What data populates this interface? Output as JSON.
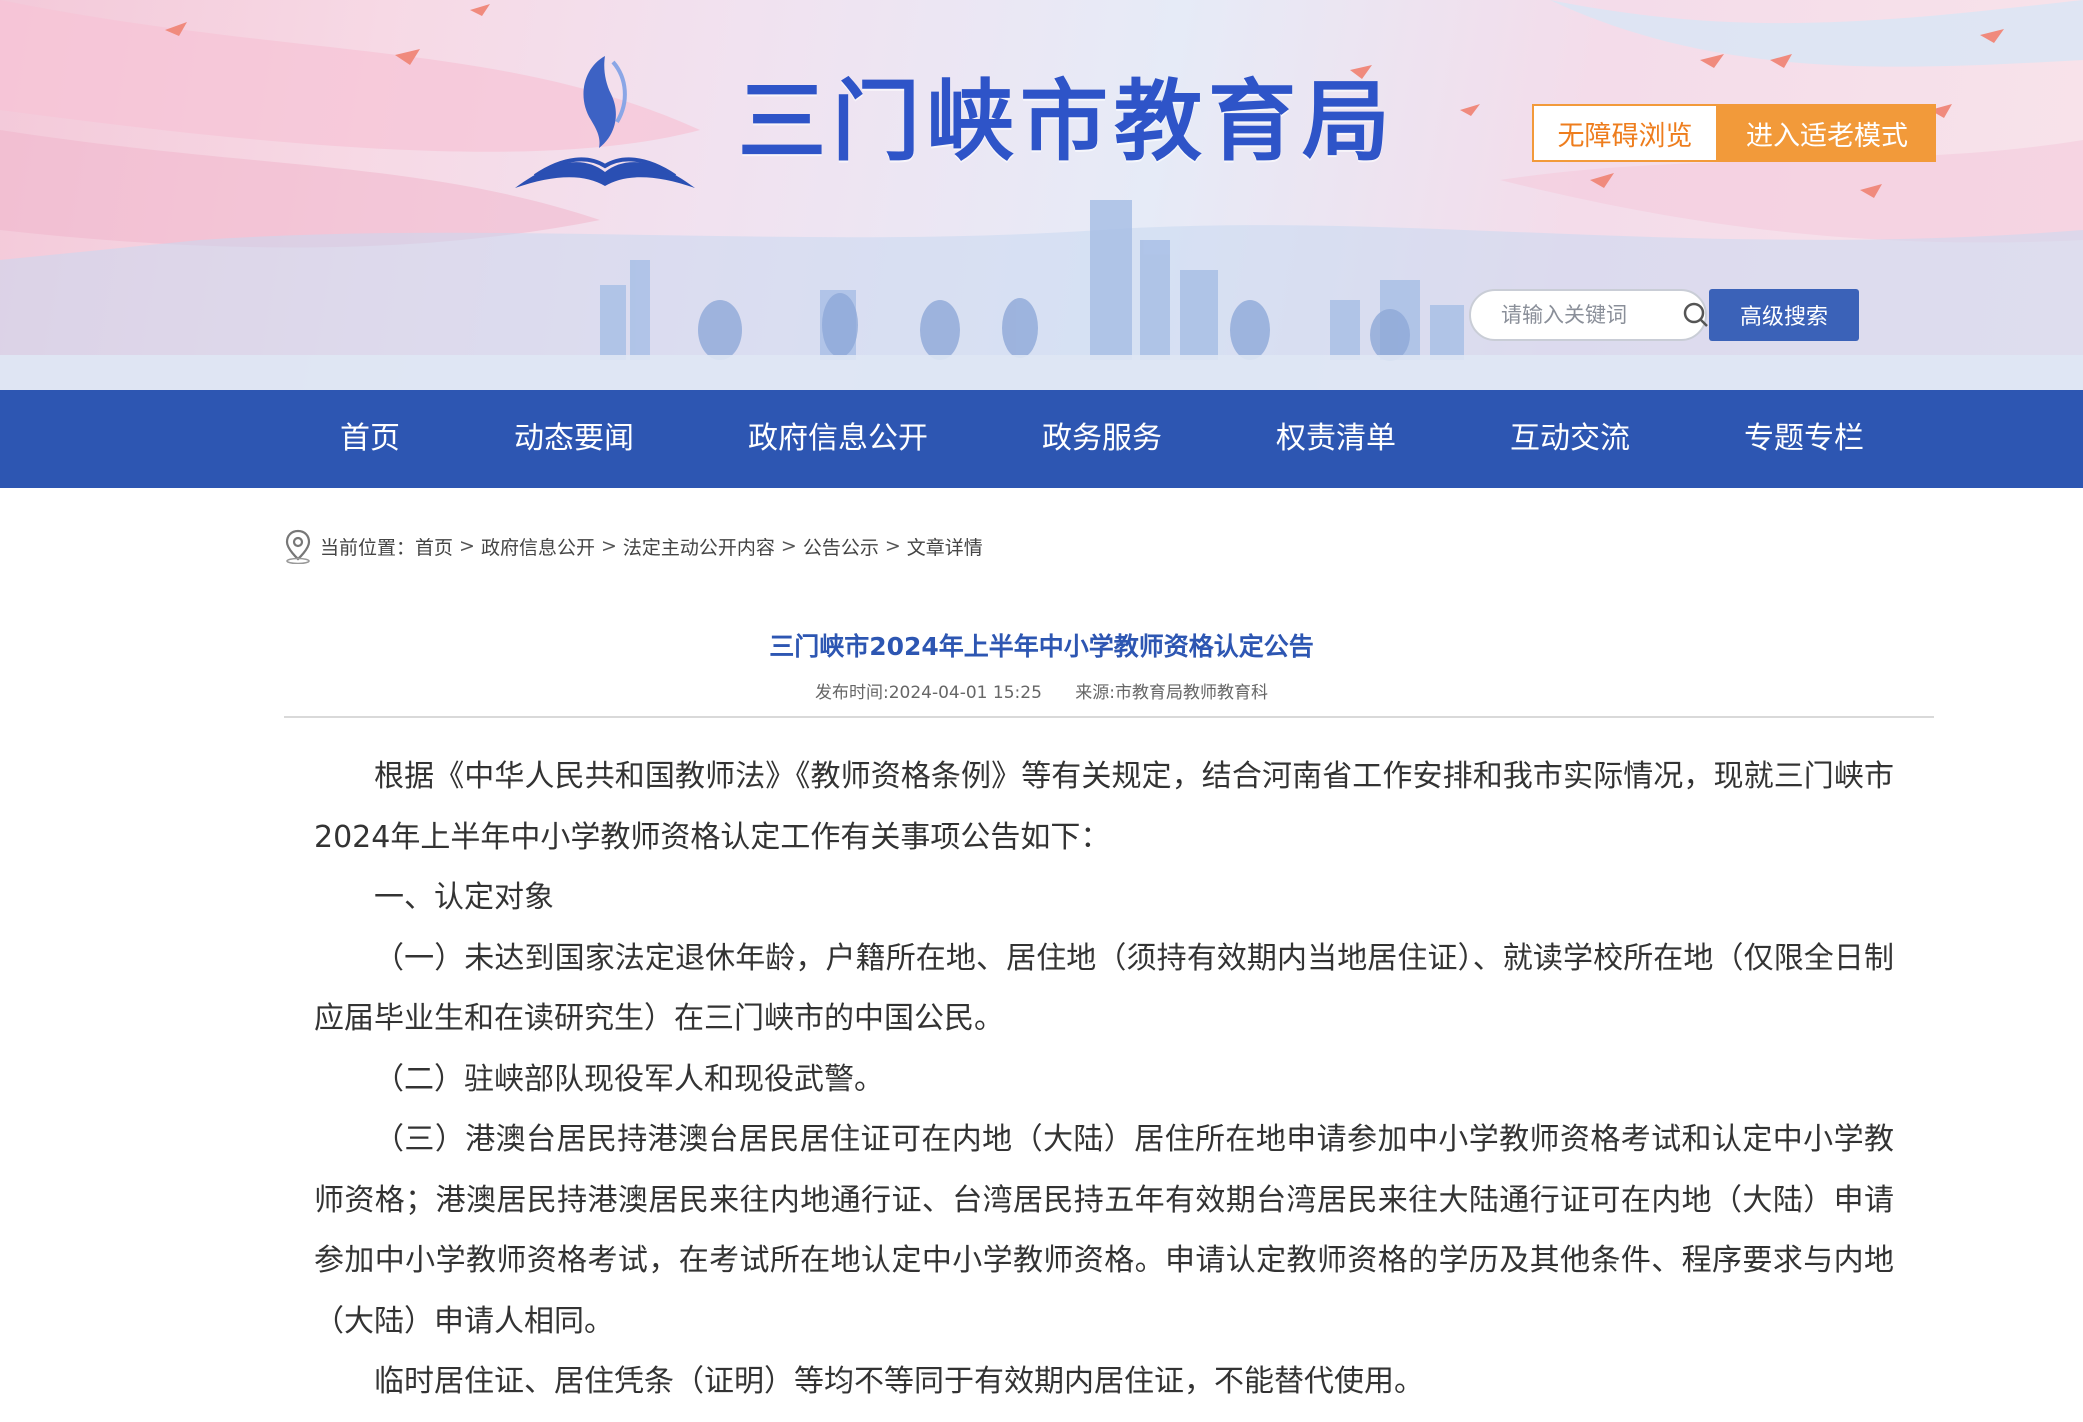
{
  "header": {
    "site_title": "三门峡市教育局",
    "accessible_label": "无障碍浏览",
    "elder_mode_label": "进入适老模式",
    "search_placeholder": "请输入关键词",
    "advanced_search_label": "高级搜索"
  },
  "nav": {
    "items": [
      {
        "label": "首页"
      },
      {
        "label": "动态要闻"
      },
      {
        "label": "政府信息公开"
      },
      {
        "label": "政务服务"
      },
      {
        "label": "权责清单"
      },
      {
        "label": "互动交流"
      },
      {
        "label": "专题专栏"
      }
    ]
  },
  "breadcrumb": {
    "prefix": "当前位置：",
    "sep": ">",
    "items": [
      "首页",
      "政府信息公开",
      "法定主动公开内容",
      "公告公示",
      "文章详情"
    ]
  },
  "article": {
    "title": "三门峡市2024年上半年中小学教师资格认定公告",
    "publish_time": "发布时间:2024-04-01 15:25",
    "source": "来源:市教育局教师教育科",
    "paragraphs": [
      "根据《中华人民共和国教师法》《教师资格条例》等有关规定，结合河南省工作安排和我市实际情况，现就三门峡市2024年上半年中小学教师资格认定工作有关事项公告如下：",
      "一、认定对象",
      "（一）未达到国家法定退休年龄，户籍所在地、居住地（须持有效期内当地居住证）、就读学校所在地（仅限全日制应届毕业生和在读研究生）在三门峡市的中国公民。",
      "（二）驻峡部队现役军人和现役武警。",
      "（三）港澳台居民持港澳台居民居住证可在内地（大陆）居住所在地申请参加中小学教师资格考试和认定中小学教师资格；港澳居民持港澳居民来往内地通行证、台湾居民持五年有效期台湾居民来往大陆通行证可在内地（大陆）申请参加中小学教师资格考试，在考试所在地认定中小学教师资格。申请认定教师资格的学历及其他条件、程序要求与内地（大陆）申请人相同。",
      "临时居住证、居住凭条（证明）等均不等同于有效期内居住证，不能替代使用。"
    ]
  },
  "colors": {
    "brand_blue": "#2d56b2",
    "title_blue": "#2e54c8",
    "accent_orange": "#f29a3a"
  }
}
